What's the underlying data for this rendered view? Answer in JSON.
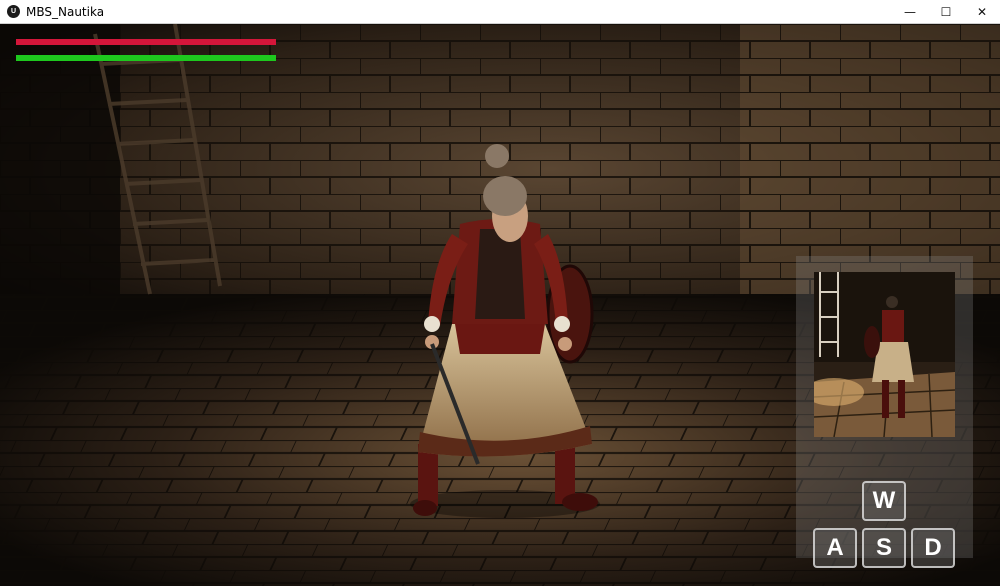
{
  "window": {
    "title": "MBS_Nautika",
    "app_icon_letter": "U",
    "minimize_symbol": "—",
    "maximize_symbol": "☐",
    "close_symbol": "✕"
  },
  "hud": {
    "health": {
      "fraction": 1.0,
      "color": "#d4163a"
    },
    "stamina": {
      "fraction": 1.0,
      "color": "#1ec81e"
    }
  },
  "controls": {
    "forward_key": "W",
    "left_key": "A",
    "back_key": "S",
    "right_key": "D"
  },
  "icons": {
    "app": "unreal-engine-logo-icon",
    "minimize": "minimize-icon",
    "maximize": "maximize-icon",
    "close": "close-icon"
  }
}
